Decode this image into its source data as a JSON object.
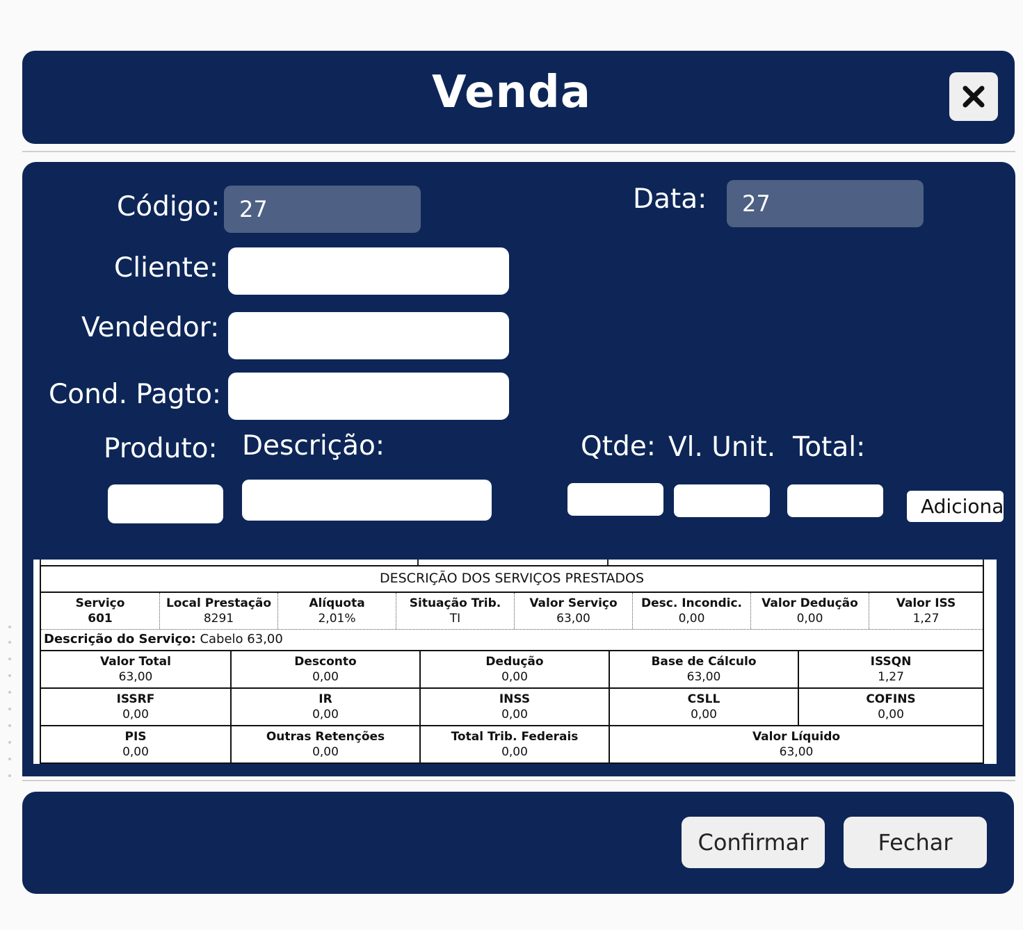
{
  "header": {
    "title": "Venda",
    "close_icon": "close-icon"
  },
  "form": {
    "codigo_label": "Código:",
    "codigo_value": "27",
    "data_label": "Data:",
    "data_value": "27",
    "cliente_label": "Cliente:",
    "vendedor_label": "Vendedor:",
    "cond_pagto_label": "Cond. Pagto:"
  },
  "items": {
    "produto_label": "Produto:",
    "descricao_label": "Descrição:",
    "qtde_label": "Qtde:",
    "vl_unit_label": "Vl. Unit.",
    "total_label": "Total:",
    "add_button": "Adicionar"
  },
  "invoice": {
    "section_title": "DESCRIÇÃO DOS SERVIÇOS PRESTADOS",
    "row1": [
      {
        "h": "Serviço",
        "v": "601"
      },
      {
        "h": "Local Prestação",
        "v": "8291"
      },
      {
        "h": "Alíquota",
        "v": "2,01%"
      },
      {
        "h": "Situação Trib.",
        "v": "TI"
      },
      {
        "h": "Valor Serviço",
        "v": "63,00"
      },
      {
        "h": "Desc. Incondic.",
        "v": "0,00"
      },
      {
        "h": "Valor Dedução",
        "v": "0,00"
      },
      {
        "h": "Valor ISS",
        "v": "1,27"
      }
    ],
    "desc_label": "Descrição do Serviço:",
    "desc_value": " Cabelo 63,00",
    "row2": [
      {
        "h": "Valor Total",
        "v": "63,00"
      },
      {
        "h": "Desconto",
        "v": "0,00"
      },
      {
        "h": "Dedução",
        "v": "0,00"
      },
      {
        "h": "Base de Cálculo",
        "v": "63,00"
      },
      {
        "h": "ISSQN",
        "v": "1,27"
      }
    ],
    "row3": [
      {
        "h": "ISSRF",
        "v": "0,00"
      },
      {
        "h": "IR",
        "v": "0,00"
      },
      {
        "h": "INSS",
        "v": "0,00"
      },
      {
        "h": "CSLL",
        "v": "0,00"
      },
      {
        "h": "COFINS",
        "v": "0,00"
      }
    ],
    "row4": [
      {
        "h": "PIS",
        "v": "0,00"
      },
      {
        "h": "Outras Retenções",
        "v": "0,00"
      },
      {
        "h": "Total Trib. Federais",
        "v": "0,00"
      },
      {
        "h": "Valor Líquido",
        "v": "63,00"
      }
    ]
  },
  "footer": {
    "confirm_button": "Confirmar",
    "close_button": "Fechar"
  },
  "colors": {
    "panel": "#0d2657",
    "readonly_field": "#4e6083",
    "button": "#efefef"
  }
}
